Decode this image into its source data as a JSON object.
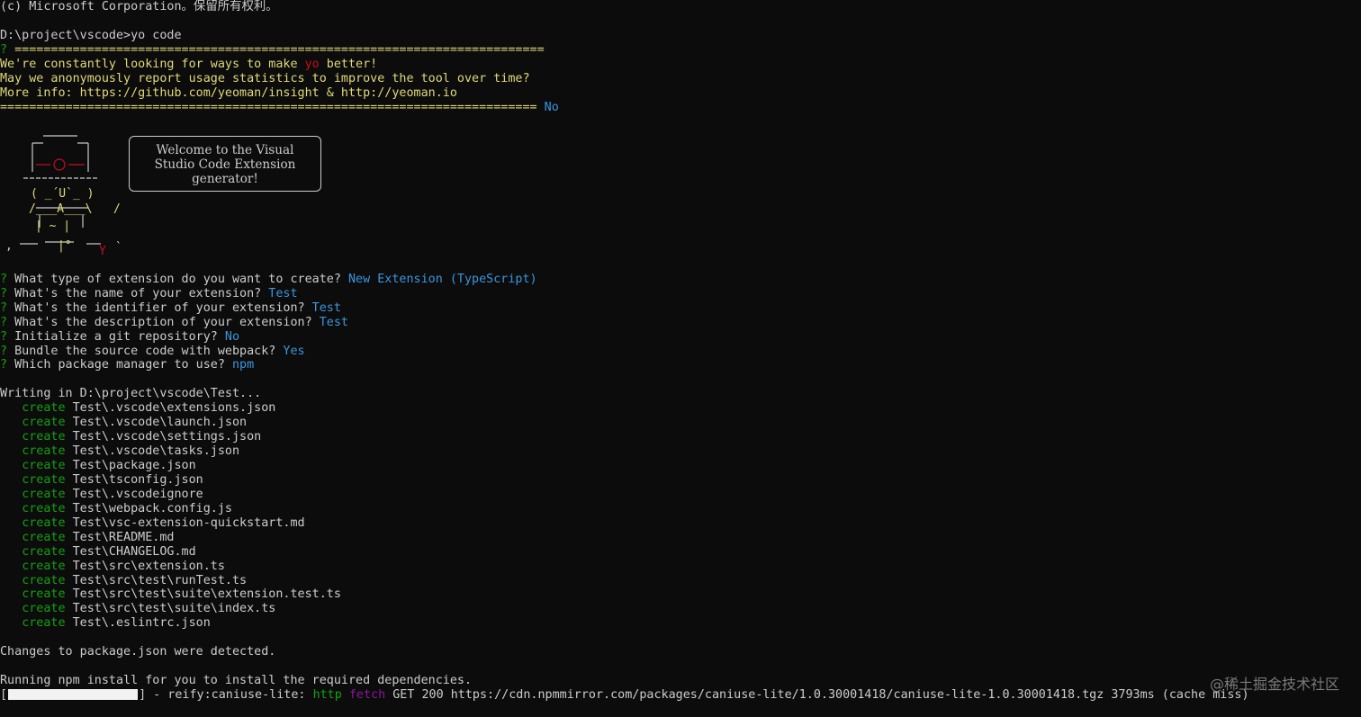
{
  "terminal": {
    "copyright": "(c) Microsoft Corporation。保留所有权利。",
    "prompt_path": "D:\\project\\vscode>",
    "command": "yo code",
    "insight": {
      "qmark": "?",
      "top_rule": "=========================================================================",
      "line1_pre": "We're constantly looking for ways to make ",
      "line1_yo": "yo",
      "line1_post": " better!",
      "line2": "May we anonymously report usage statistics to improve the tool over time?",
      "line3": "More info: https://github.com/yeoman/insight & http://yeoman.io",
      "bottom_rule": "==========================================================================",
      "answer": "No"
    },
    "welcome_box": {
      "line1": "Welcome to the Visual",
      "line2": "Studio Code Extension",
      "line3": "generator!"
    },
    "questions": [
      {
        "mark": "?",
        "text": "What type of extension do you want to create?",
        "answer": "New Extension (TypeScript)"
      },
      {
        "mark": "?",
        "text": "What's the name of your extension?",
        "answer": "Test"
      },
      {
        "mark": "?",
        "text": "What's the identifier of your extension?",
        "answer": "Test"
      },
      {
        "mark": "?",
        "text": "What's the description of your extension?",
        "answer": "Test"
      },
      {
        "mark": "?",
        "text": "Initialize a git repository?",
        "answer": "No"
      },
      {
        "mark": "?",
        "text": "Bundle the source code with webpack?",
        "answer": "Yes"
      },
      {
        "mark": "?",
        "text": "Which package manager to use?",
        "answer": "npm"
      }
    ],
    "writing_line": "Writing in D:\\project\\vscode\\Test...",
    "create_word": "create",
    "created_files": [
      "Test\\.vscode\\extensions.json",
      "Test\\.vscode\\launch.json",
      "Test\\.vscode\\settings.json",
      "Test\\.vscode\\tasks.json",
      "Test\\package.json",
      "Test\\tsconfig.json",
      "Test\\.vscodeignore",
      "Test\\webpack.config.js",
      "Test\\vsc-extension-quickstart.md",
      "Test\\README.md",
      "Test\\CHANGELOG.md",
      "Test\\src\\extension.ts",
      "Test\\src\\test\\runTest.ts",
      "Test\\src\\test\\suite\\extension.test.ts",
      "Test\\src\\test\\suite\\index.ts",
      "Test\\.eslintrc.json"
    ],
    "changes_detected": "Changes to package.json were detected.",
    "running_npm": "Running npm install for you to install the required dependencies.",
    "progress": {
      "open_bracket": "[",
      "close_bracket": "]",
      "fill_fraction": 1.0,
      "text_pre": " - reify:caniuse-lite: ",
      "http": "http",
      "fetch": "fetch",
      "text_post": " GET 200 https://cdn.npmmirror.com/packages/caniuse-lite/1.0.30001418/caniuse-lite-1.0.30001418.tgz 3793ms (cache miss)"
    }
  },
  "watermark": "@稀土掘金技术社区",
  "colors": {
    "background": "#0c0c0c",
    "foreground": "#cccccc",
    "green": "#13a10e",
    "yellow": "#e0d97a",
    "red": "#c50f1f",
    "cyan": "#3a96dd",
    "magenta": "#881798"
  }
}
